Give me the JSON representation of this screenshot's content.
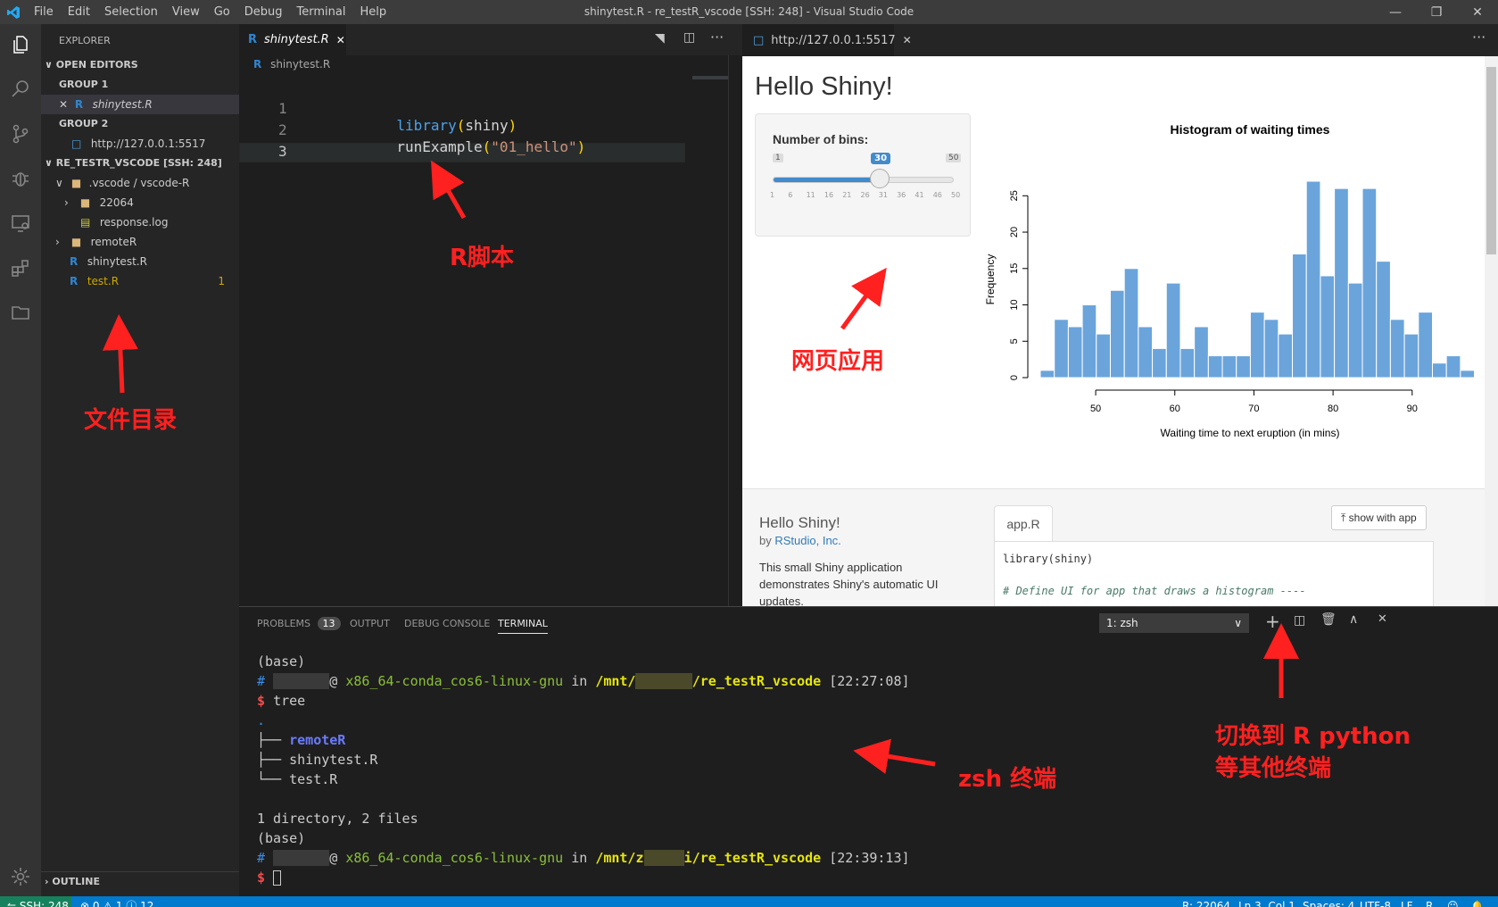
{
  "titlebar": {
    "menu": [
      "File",
      "Edit",
      "Selection",
      "View",
      "Go",
      "Debug",
      "Terminal",
      "Help"
    ],
    "title": "shinytest.R - re_testR_vscode [SSH: 248] - Visual Studio Code"
  },
  "sidebar": {
    "header": "EXPLORER",
    "open_editors": "OPEN EDITORS",
    "group1": "GROUP 1",
    "group1_file": "shinytest.R",
    "group2": "GROUP 2",
    "group2_file": "http://127.0.0.1:5517",
    "workspace": "RE_TESTR_VSCODE [SSH: 248]",
    "tree": {
      "vscode": ".vscode / vscode-R",
      "folder_22064": "22064",
      "response": "response.log",
      "remoteR": "remoteR",
      "shinytest": "shinytest.R",
      "testR": "test.R",
      "testR_badge": "1"
    },
    "outline": "OUTLINE"
  },
  "editor": {
    "tab": "shinytest.R",
    "breadcrumb": "shinytest.R",
    "lines": [
      {
        "num": "1",
        "fn": "library",
        "open": "(",
        "arg": "shiny",
        "close": ")"
      },
      {
        "num": "2",
        "fn": "runExample",
        "open": "(",
        "arg": "\"01_hello\"",
        "close": ")"
      },
      {
        "num": "3"
      }
    ]
  },
  "browser": {
    "tab": "http://127.0.0.1:5517",
    "page_title": "Hello Shiny!",
    "bins_label": "Number of bins:",
    "slider": {
      "min": "1",
      "max": "50",
      "value": "30",
      "fraction": 0.592,
      "ticks": [
        "1",
        "6",
        "11",
        "16",
        "21",
        "26",
        "31",
        "36",
        "41",
        "46",
        "50"
      ]
    },
    "app_title": "Hello Shiny!",
    "by": "by",
    "author": "RStudio, Inc.",
    "desc": "This small Shiny application demonstrates Shiny's automatic UI updates.",
    "code_tab": "app.R",
    "show_with_app": "show with app",
    "code_line1": "library(shiny)",
    "code_line2": "# Define UI for app that draws a histogram ----"
  },
  "chart_data": {
    "type": "bar",
    "title": "Histogram of waiting times",
    "xlabel": "Waiting time to next eruption (in mins)",
    "ylabel": "Frequency",
    "xlim": [
      43,
      96
    ],
    "ylim": [
      0,
      27
    ],
    "xticks": [
      "50",
      "60",
      "70",
      "80",
      "90"
    ],
    "yticks": [
      "0",
      "5",
      "10",
      "15",
      "20",
      "25"
    ],
    "bin_start": 43,
    "bin_width": 1.77,
    "values": [
      1,
      8,
      7,
      10,
      6,
      12,
      15,
      7,
      4,
      13,
      4,
      7,
      3,
      3,
      3,
      9,
      8,
      6,
      17,
      27,
      14,
      26,
      13,
      26,
      16,
      8,
      6,
      9,
      2,
      3,
      1
    ],
    "bar_color": "#6aa4db"
  },
  "panel": {
    "tabs": {
      "problems": "PROBLEMS",
      "problems_count": "13",
      "output": "OUTPUT",
      "debug": "DEBUG CONSOLE",
      "terminal": "TERMINAL"
    },
    "terminal_select": "1: zsh",
    "term": {
      "base": "(base)",
      "hash": "#",
      "at": "@",
      "host": "x86_64-conda_cos6-linux-gnu",
      "in": "in",
      "path1": "/mnt/",
      "path1b": "/re_testR_vscode",
      "time1": "[22:27:08]",
      "dollar": "$",
      "cmd": "tree",
      "dot": ".",
      "t1": "├── ",
      "remoteR": "remoteR",
      "t2": "├── shinytest.R",
      "t3": "└── test.R",
      "summary": "1 directory, 2 files",
      "path2": "/mnt/z",
      "path2b": "i/re_testR_vscode",
      "time2": "[22:39:13]"
    }
  },
  "status": {
    "remote": "SSH: 248",
    "problems": "⊗ 0 ⚠ 1 ⓘ 12",
    "r_pid": "R: 22064",
    "pos": "Ln 3, Col 1",
    "spaces": "Spaces: 4",
    "enc": "UTF-8",
    "eol": "LF",
    "lang": "R"
  },
  "annotations": {
    "explorer": "文件目录",
    "rscript": "R脚本",
    "webapp": "网页应用",
    "zsh": "zsh 终端",
    "switch1": "切换到 R python",
    "switch2": "等其他终端"
  },
  "colors": {
    "accent": "#007acc",
    "annotation": "#ff2020",
    "folder": "#dcb67a"
  }
}
